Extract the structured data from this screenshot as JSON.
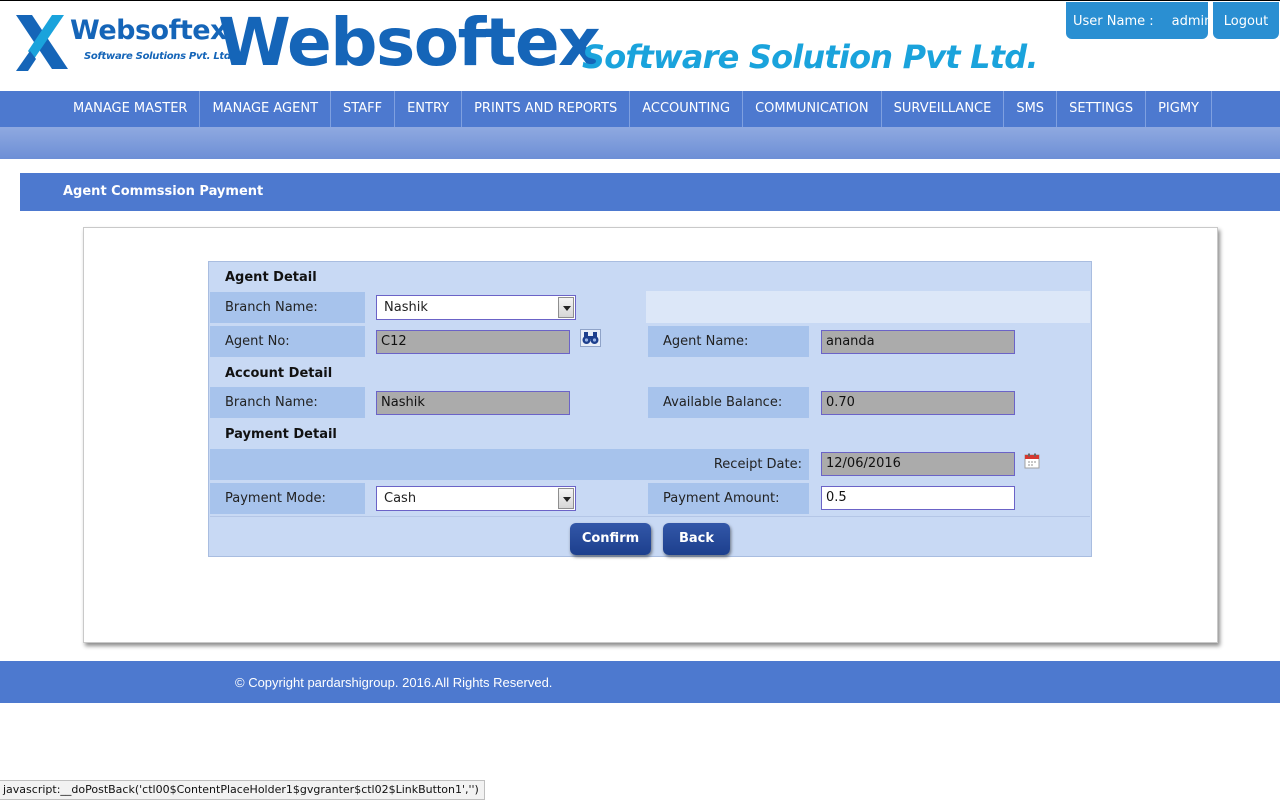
{
  "header": {
    "logo_name": "Websoftex",
    "logo_tagline": "Software Solutions Pvt. Ltd.",
    "brand_title": "Websoftex",
    "brand_subtitle": "Software Solution Pvt Ltd.",
    "user_label": "User Name :",
    "user_name": "admin",
    "logout_label": "Logout"
  },
  "nav": {
    "items": [
      "MANAGE MASTER",
      "MANAGE AGENT",
      "STAFF",
      "ENTRY",
      "PRINTS AND REPORTS",
      "ACCOUNTING",
      "COMMUNICATION",
      "SURVEILLANCE",
      "SMS",
      "SETTINGS",
      "PIGMY"
    ]
  },
  "page": {
    "title": "Agent Commssion Payment"
  },
  "form": {
    "agent_detail": {
      "heading": "Agent Detail",
      "branch_label": "Branch Name:",
      "branch_value": "Nashik",
      "agent_no_label": "Agent No:",
      "agent_no_value": "C12",
      "agent_name_label": "Agent Name:",
      "agent_name_value": "ananda"
    },
    "account_detail": {
      "heading": "Account Detail",
      "branch_label": "Branch Name:",
      "branch_value": "Nashik",
      "balance_label": "Available Balance:",
      "balance_value": "0.70"
    },
    "payment_detail": {
      "heading": "Payment Detail",
      "receipt_date_label": "Receipt Date:",
      "receipt_date_value": "12/06/2016",
      "mode_label": "Payment Mode:",
      "mode_value": "Cash",
      "amount_label": "Payment Amount:",
      "amount_value": "0.5"
    },
    "buttons": {
      "confirm": "Confirm",
      "back": "Back"
    }
  },
  "footer": {
    "copyright": "© Copyright pardarshigroup. 2016.All Rights Reserved."
  },
  "status_bar": {
    "text": "javascript:__doPostBack('ctl00$ContentPlaceHolder1$gvgranter$ctl02$LinkButton1','')"
  },
  "colors": {
    "brand_blue": "#1565b8",
    "brand_cyan": "#1aa3dc",
    "nav_blue": "#4d79cf",
    "button_blue": "#1d3f8d",
    "form_bg": "#c8d9f4",
    "label_bg": "#a7c3ec"
  }
}
